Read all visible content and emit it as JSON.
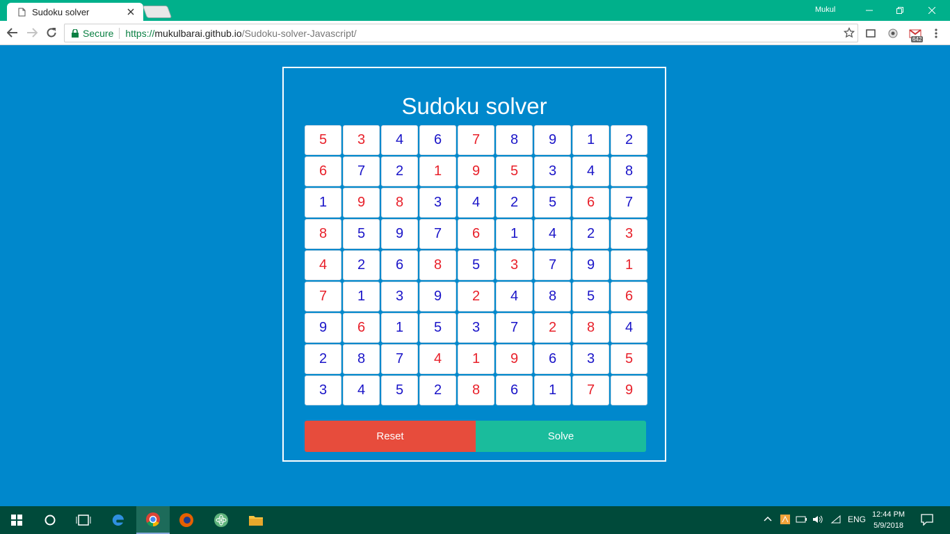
{
  "browser": {
    "tab_title": "Sudoku solver",
    "profile": "Mukul",
    "secure_label": "Secure",
    "url_scheme": "https://",
    "url_host": "mukulbarai.github.io",
    "url_path": "/Sudoku-solver-Javascript/",
    "gmail_badge": "642"
  },
  "page": {
    "title": "Sudoku solver",
    "reset_label": "Reset",
    "solve_label": "Solve",
    "colors": {
      "given": "#e8202a",
      "solved": "#1a14c8",
      "reset": "#e74c3c",
      "solve": "#1abc9c",
      "background": "#0088cc"
    }
  },
  "grid": [
    [
      {
        "v": "5",
        "t": "given"
      },
      {
        "v": "3",
        "t": "given"
      },
      {
        "v": "4",
        "t": "solved"
      },
      {
        "v": "6",
        "t": "solved"
      },
      {
        "v": "7",
        "t": "given"
      },
      {
        "v": "8",
        "t": "solved"
      },
      {
        "v": "9",
        "t": "solved"
      },
      {
        "v": "1",
        "t": "solved"
      },
      {
        "v": "2",
        "t": "solved"
      }
    ],
    [
      {
        "v": "6",
        "t": "given"
      },
      {
        "v": "7",
        "t": "solved"
      },
      {
        "v": "2",
        "t": "solved"
      },
      {
        "v": "1",
        "t": "given"
      },
      {
        "v": "9",
        "t": "given"
      },
      {
        "v": "5",
        "t": "given"
      },
      {
        "v": "3",
        "t": "solved"
      },
      {
        "v": "4",
        "t": "solved"
      },
      {
        "v": "8",
        "t": "solved"
      }
    ],
    [
      {
        "v": "1",
        "t": "solved"
      },
      {
        "v": "9",
        "t": "given"
      },
      {
        "v": "8",
        "t": "given"
      },
      {
        "v": "3",
        "t": "solved"
      },
      {
        "v": "4",
        "t": "solved"
      },
      {
        "v": "2",
        "t": "solved"
      },
      {
        "v": "5",
        "t": "solved"
      },
      {
        "v": "6",
        "t": "given"
      },
      {
        "v": "7",
        "t": "solved"
      }
    ],
    [
      {
        "v": "8",
        "t": "given"
      },
      {
        "v": "5",
        "t": "solved"
      },
      {
        "v": "9",
        "t": "solved"
      },
      {
        "v": "7",
        "t": "solved"
      },
      {
        "v": "6",
        "t": "given"
      },
      {
        "v": "1",
        "t": "solved"
      },
      {
        "v": "4",
        "t": "solved"
      },
      {
        "v": "2",
        "t": "solved"
      },
      {
        "v": "3",
        "t": "given"
      }
    ],
    [
      {
        "v": "4",
        "t": "given"
      },
      {
        "v": "2",
        "t": "solved"
      },
      {
        "v": "6",
        "t": "solved"
      },
      {
        "v": "8",
        "t": "given"
      },
      {
        "v": "5",
        "t": "solved"
      },
      {
        "v": "3",
        "t": "given"
      },
      {
        "v": "7",
        "t": "solved"
      },
      {
        "v": "9",
        "t": "solved"
      },
      {
        "v": "1",
        "t": "given"
      }
    ],
    [
      {
        "v": "7",
        "t": "given"
      },
      {
        "v": "1",
        "t": "solved"
      },
      {
        "v": "3",
        "t": "solved"
      },
      {
        "v": "9",
        "t": "solved"
      },
      {
        "v": "2",
        "t": "given"
      },
      {
        "v": "4",
        "t": "solved"
      },
      {
        "v": "8",
        "t": "solved"
      },
      {
        "v": "5",
        "t": "solved"
      },
      {
        "v": "6",
        "t": "given"
      }
    ],
    [
      {
        "v": "9",
        "t": "solved"
      },
      {
        "v": "6",
        "t": "given"
      },
      {
        "v": "1",
        "t": "solved"
      },
      {
        "v": "5",
        "t": "solved"
      },
      {
        "v": "3",
        "t": "solved"
      },
      {
        "v": "7",
        "t": "solved"
      },
      {
        "v": "2",
        "t": "given"
      },
      {
        "v": "8",
        "t": "given"
      },
      {
        "v": "4",
        "t": "solved"
      }
    ],
    [
      {
        "v": "2",
        "t": "solved"
      },
      {
        "v": "8",
        "t": "solved"
      },
      {
        "v": "7",
        "t": "solved"
      },
      {
        "v": "4",
        "t": "given"
      },
      {
        "v": "1",
        "t": "given"
      },
      {
        "v": "9",
        "t": "given"
      },
      {
        "v": "6",
        "t": "solved"
      },
      {
        "v": "3",
        "t": "solved"
      },
      {
        "v": "5",
        "t": "given"
      }
    ],
    [
      {
        "v": "3",
        "t": "solved"
      },
      {
        "v": "4",
        "t": "solved"
      },
      {
        "v": "5",
        "t": "solved"
      },
      {
        "v": "2",
        "t": "solved"
      },
      {
        "v": "8",
        "t": "given"
      },
      {
        "v": "6",
        "t": "solved"
      },
      {
        "v": "1",
        "t": "solved"
      },
      {
        "v": "7",
        "t": "given"
      },
      {
        "v": "9",
        "t": "given"
      }
    ]
  ],
  "taskbar": {
    "items": [
      "start-icon",
      "cortana-icon",
      "task-view-icon",
      "edge-icon",
      "chrome-icon",
      "firefox-icon",
      "atom-icon",
      "file-explorer-icon"
    ],
    "language": "ENG",
    "time": "12:44 PM",
    "date": "5/9/2018"
  }
}
